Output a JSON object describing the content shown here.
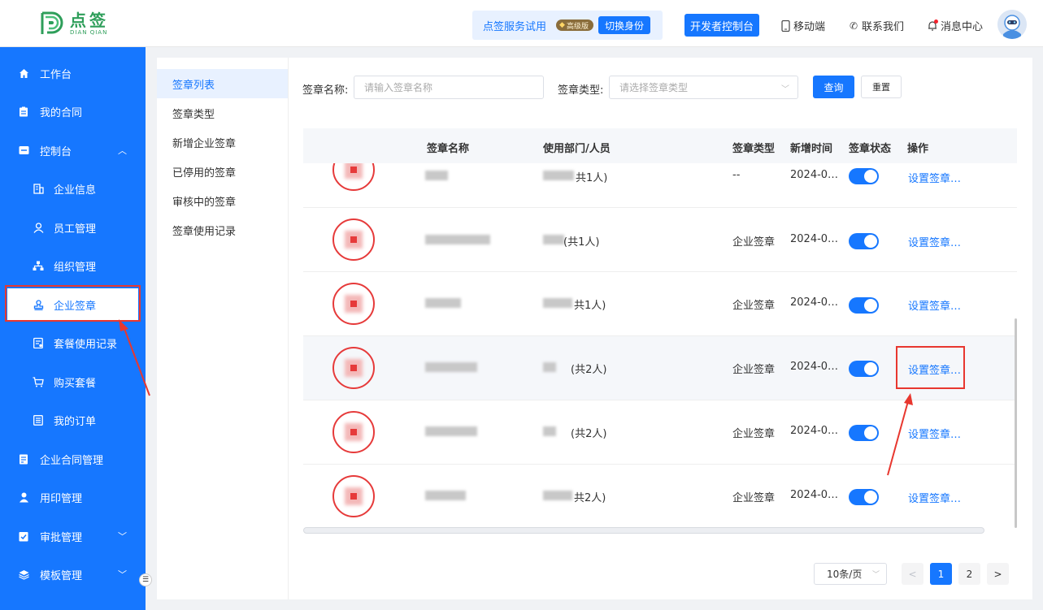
{
  "header": {
    "logo_cn": "点签",
    "logo_en": "DIAN QIAN",
    "trial_text": "点签服务试用",
    "vip_badge": "高级版",
    "switch_identity": "切换身份",
    "developer_console": "开发者控制台",
    "mobile": "移动端",
    "contact": "联系我们",
    "messages": "消息中心"
  },
  "sidebar": {
    "items": [
      {
        "label": "工作台",
        "icon": "home-icon"
      },
      {
        "label": "我的合同",
        "icon": "clipboard-icon"
      },
      {
        "label": "控制台",
        "icon": "console-icon"
      },
      {
        "label": "企业信息",
        "icon": "building-icon"
      },
      {
        "label": "员工管理",
        "icon": "user-icon"
      },
      {
        "label": "组织管理",
        "icon": "org-tree-icon"
      },
      {
        "label": "企业签章",
        "icon": "stamp-icon"
      },
      {
        "label": "套餐使用记录",
        "icon": "record-icon"
      },
      {
        "label": "购买套餐",
        "icon": "cart-icon"
      },
      {
        "label": "我的订单",
        "icon": "order-icon"
      },
      {
        "label": "企业合同管理",
        "icon": "contract-icon"
      },
      {
        "label": "用印管理",
        "icon": "seal-user-icon"
      },
      {
        "label": "审批管理",
        "icon": "approval-icon"
      },
      {
        "label": "模板管理",
        "icon": "layers-icon"
      }
    ],
    "active": "企业签章"
  },
  "subnav": {
    "items": [
      "签章列表",
      "签章类型",
      "新增企业签章",
      "已停用的签章",
      "审核中的签章",
      "签章使用记录"
    ],
    "active": "签章列表"
  },
  "filters": {
    "name_label": "签章名称:",
    "name_placeholder": "请输入签章名称",
    "type_label": "签章类型:",
    "type_placeholder": "请选择签章类型",
    "query": "查询",
    "reset": "重置"
  },
  "table": {
    "columns": [
      "签章名称",
      "使用部门/人员",
      "签章类型",
      "新增时间",
      "签章状态",
      "操作"
    ],
    "rows": [
      {
        "dept": "共1人)",
        "type": "--",
        "time": "2024-0…",
        "enabled": true,
        "action": "设置签章…"
      },
      {
        "dept": "(共1人)",
        "type": "企业签章",
        "time": "2024-0…",
        "enabled": true,
        "action": "设置签章…"
      },
      {
        "dept": "共1人)",
        "type": "企业签章",
        "time": "2024-0…",
        "enabled": true,
        "action": "设置签章…"
      },
      {
        "dept": "(共2人)",
        "type": "企业签章",
        "time": "2024-0…",
        "enabled": true,
        "action": "设置签章…"
      },
      {
        "dept": "(共2人)",
        "type": "企业签章",
        "time": "2024-0…",
        "enabled": true,
        "action": "设置签章…"
      },
      {
        "dept": "共2人)",
        "type": "企业签章",
        "time": "2024-0…",
        "enabled": true,
        "action": "设置签章…"
      }
    ]
  },
  "pagination": {
    "page_size": "10条/页",
    "pages": [
      "1",
      "2"
    ],
    "current": "1",
    "prev": "<",
    "next": ">"
  },
  "colors": {
    "primary": "#1677ff",
    "annotation": "#e8372f",
    "stamp_red": "#e63a3a",
    "logo_green": "#2e9e5a"
  }
}
